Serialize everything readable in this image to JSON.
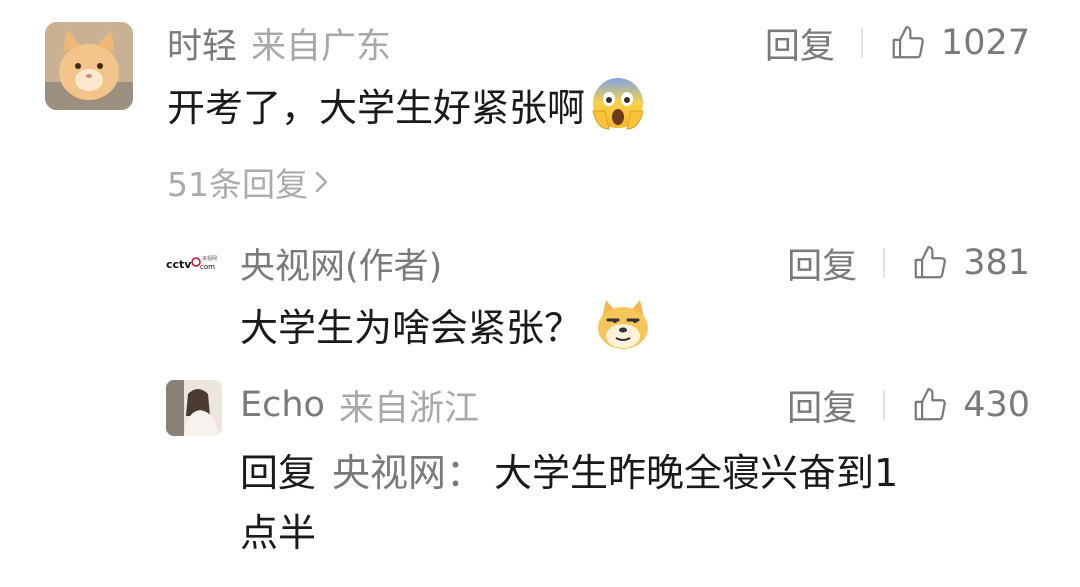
{
  "comments": [
    {
      "username": "时轻",
      "location": "来自广东",
      "text": "开考了，大学生好紧张啊",
      "reply_label": "回复",
      "likes": "1027",
      "replies_link": "51条回复",
      "emoji": "scream-emoji"
    }
  ],
  "replies": [
    {
      "username": "央视网(作者)",
      "avatar_text": "cctv.com",
      "avatar_small": "央视网",
      "text": "大学生为啥会紧张？",
      "reply_label": "回复",
      "likes": "381",
      "emoji": "doge-emoji"
    },
    {
      "username": "Echo",
      "location": "来自浙江",
      "reply_prefix": "回复",
      "reply_target": "央视网：",
      "text_line1": "大学生昨晚全寝兴奋到1",
      "text_line2": "点半",
      "reply_label": "回复",
      "likes": "430"
    }
  ],
  "colors": {
    "username": "#7a7a7a",
    "location": "#a8a8a8",
    "text": "#1a1a1a",
    "accent_cctv": "#c8102e"
  }
}
